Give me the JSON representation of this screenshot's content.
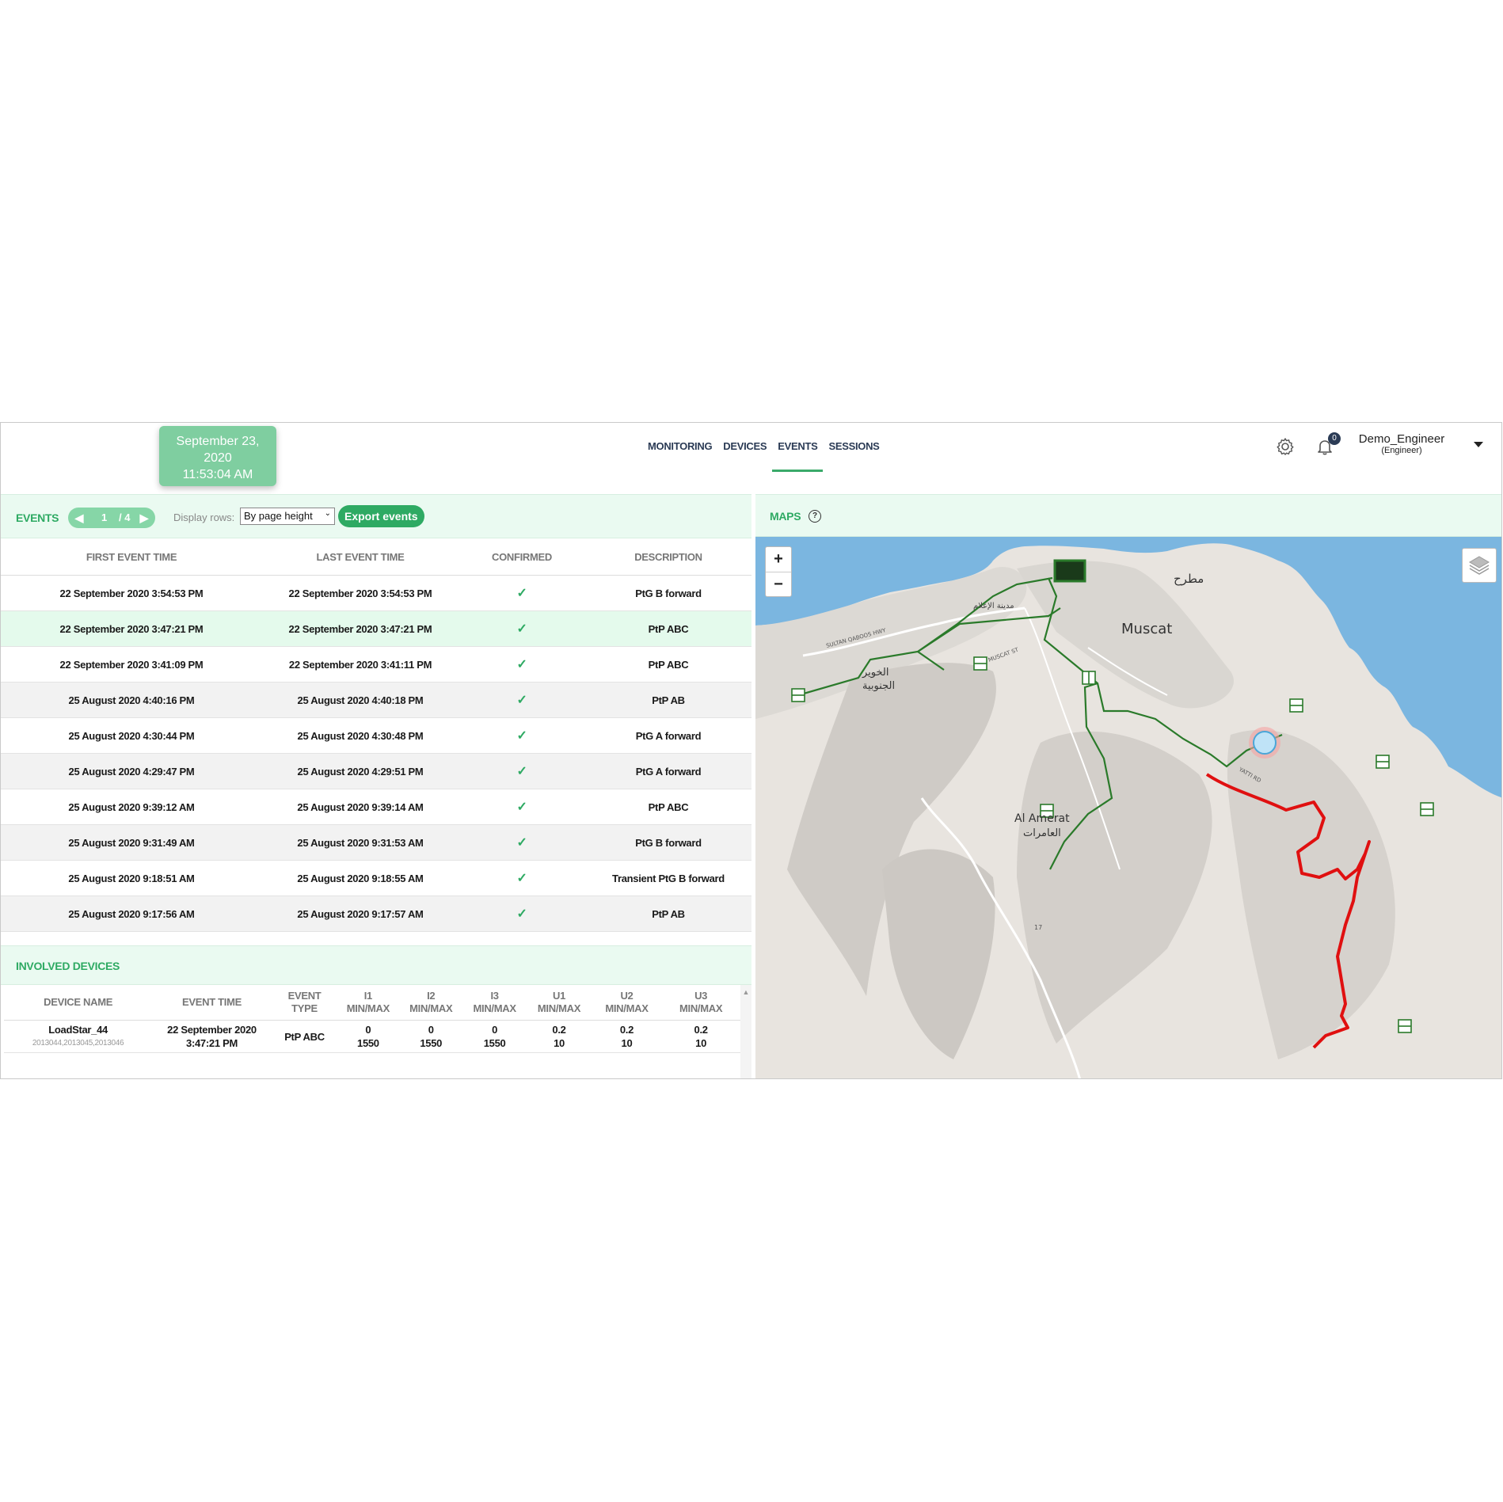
{
  "header": {
    "date_line1": "September 23,",
    "date_line2": "2020",
    "time": "11:53:04 AM",
    "nav": [
      "MONITORING",
      "DEVICES",
      "EVENTS",
      "SESSIONS"
    ],
    "active_nav": "EVENTS",
    "notifications_count": "0",
    "user_name": "Demo_Engineer",
    "user_role": "(Engineer)"
  },
  "events": {
    "title": "EVENTS",
    "page": "1",
    "page_total": "/ 4",
    "display_rows_label": "Display rows:",
    "display_rows_value": "By page height",
    "export_label": "Export events",
    "columns": [
      "FIRST EVENT TIME",
      "LAST EVENT TIME",
      "CONFIRMED",
      "DESCRIPTION"
    ],
    "confirmed_glyph": "✓",
    "rows": [
      {
        "first": "22 September 2020 3:54:53 PM",
        "last": "22 September 2020 3:54:53 PM",
        "confirmed": true,
        "description": "PtG B forward"
      },
      {
        "first": "22 September 2020 3:47:21 PM",
        "last": "22 September 2020 3:47:21 PM",
        "confirmed": true,
        "description": "PtP ABC"
      },
      {
        "first": "22 September 2020 3:41:09 PM",
        "last": "22 September 2020 3:41:11 PM",
        "confirmed": true,
        "description": "PtP ABC"
      },
      {
        "first": "25 August 2020 4:40:16 PM",
        "last": "25 August 2020 4:40:18 PM",
        "confirmed": true,
        "description": "PtP AB"
      },
      {
        "first": "25 August 2020 4:30:44 PM",
        "last": "25 August 2020 4:30:48 PM",
        "confirmed": true,
        "description": "PtG A forward"
      },
      {
        "first": "25 August 2020 4:29:47 PM",
        "last": "25 August 2020 4:29:51 PM",
        "confirmed": true,
        "description": "PtG A forward"
      },
      {
        "first": "25 August 2020 9:39:12 AM",
        "last": "25 August 2020 9:39:14 AM",
        "confirmed": true,
        "description": "PtP ABC"
      },
      {
        "first": "25 August 2020 9:31:49 AM",
        "last": "25 August 2020 9:31:53 AM",
        "confirmed": true,
        "description": "PtG B forward"
      },
      {
        "first": "25 August 2020 9:18:51 AM",
        "last": "25 August 2020 9:18:55 AM",
        "confirmed": true,
        "description": "Transient PtG B forward"
      },
      {
        "first": "25 August 2020 9:17:56 AM",
        "last": "25 August 2020 9:17:57 AM",
        "confirmed": true,
        "description": "PtP AB"
      }
    ],
    "selected_row": 1
  },
  "involved_devices": {
    "title": "INVOLVED DEVICES",
    "columns": [
      [
        "DEVICE NAME"
      ],
      [
        "EVENT TIME"
      ],
      [
        "EVENT",
        "TYPE"
      ],
      [
        "I1",
        "MIN/MAX"
      ],
      [
        "I2",
        "MIN/MAX"
      ],
      [
        "I3",
        "MIN/MAX"
      ],
      [
        "U1",
        "MIN/MAX"
      ],
      [
        "U2",
        "MIN/MAX"
      ],
      [
        "U3",
        "MIN/MAX"
      ]
    ],
    "rows": [
      {
        "device_name": "LoadStar_44",
        "device_ids": "2013044,2013045,2013046",
        "event_time_1": "22 September 2020",
        "event_time_2": "3:47:21 PM",
        "event_type": "PtP ABC",
        "i1": [
          "0",
          "1550"
        ],
        "i2": [
          "0",
          "1550"
        ],
        "i3": [
          "0",
          "1550"
        ],
        "u1": [
          "0.2",
          "10"
        ],
        "u2": [
          "0.2",
          "10"
        ],
        "u3": [
          "0.2",
          "10"
        ]
      }
    ]
  },
  "maps": {
    "title": "MAPS",
    "help_glyph": "?",
    "zoom_in": "+",
    "zoom_out": "−",
    "labels": {
      "muscat": "Muscat",
      "matrah": "مطرح",
      "alamerat": "Al Amerat",
      "alamerat_ar": "العامرات",
      "khuwair": "الخوير",
      "khuwair2": "الجنوبية",
      "media_city": "مدينة الإعلام",
      "sultan_qaboos_hwy": "SULTAN QABOOS HWY",
      "muscat_st": "MUSCAT ST",
      "yatti_rd": "YATTI RD",
      "rd17": "17"
    },
    "colors": {
      "sea": "#7bb6e0",
      "land": "#e8e4df",
      "green_line": "#2a7a2a",
      "red_line": "#e01010"
    }
  },
  "icons": {
    "settings": "gear-icon",
    "notifications": "bell-icon",
    "user_menu": "caret-down-icon"
  }
}
